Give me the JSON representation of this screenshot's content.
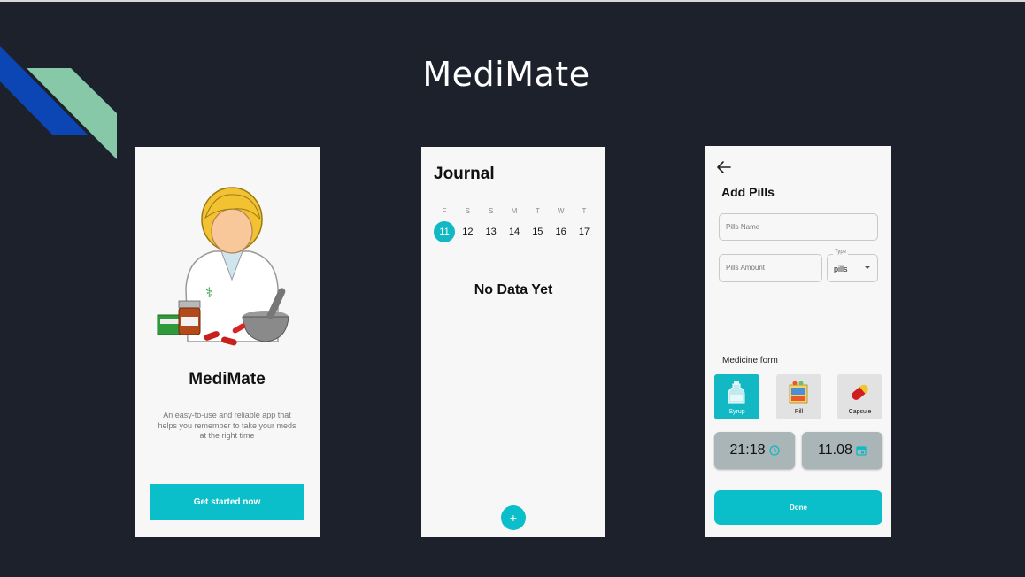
{
  "slide": {
    "title": "MediMate"
  },
  "screens": {
    "welcome": {
      "app_name": "MediMate",
      "description": "An easy-to-use and reliable app that helps you remember to take your meds at the right time",
      "cta_label": "Get started now"
    },
    "journal": {
      "title": "Journal",
      "weekdays": [
        "F",
        "S",
        "S",
        "M",
        "T",
        "W",
        "T"
      ],
      "dates": [
        "11",
        "12",
        "13",
        "14",
        "15",
        "16",
        "17"
      ],
      "selected_date": "11",
      "empty_text": "No Data Yet",
      "fab_label": "+"
    },
    "add_pills": {
      "title": "Add Pills",
      "name_placeholder": "Pills Name",
      "amount_placeholder": "Pills Amount",
      "type_label": "Type",
      "type_value": "pills",
      "medicine_form_label": "Medicine form",
      "forms": [
        {
          "label": "Syrup",
          "icon": "syrup-bottle-icon",
          "selected": true
        },
        {
          "label": "Pill",
          "icon": "pill-box-icon",
          "selected": false
        },
        {
          "label": "Capsule",
          "icon": "capsule-icon",
          "selected": false
        }
      ],
      "time_value": "21:18",
      "date_value": "11.08",
      "done_label": "Done"
    }
  },
  "colors": {
    "background": "#1c212c",
    "accent": "#0abfca",
    "deco_blue": "#0b46b4",
    "deco_green": "#86c8a8"
  }
}
